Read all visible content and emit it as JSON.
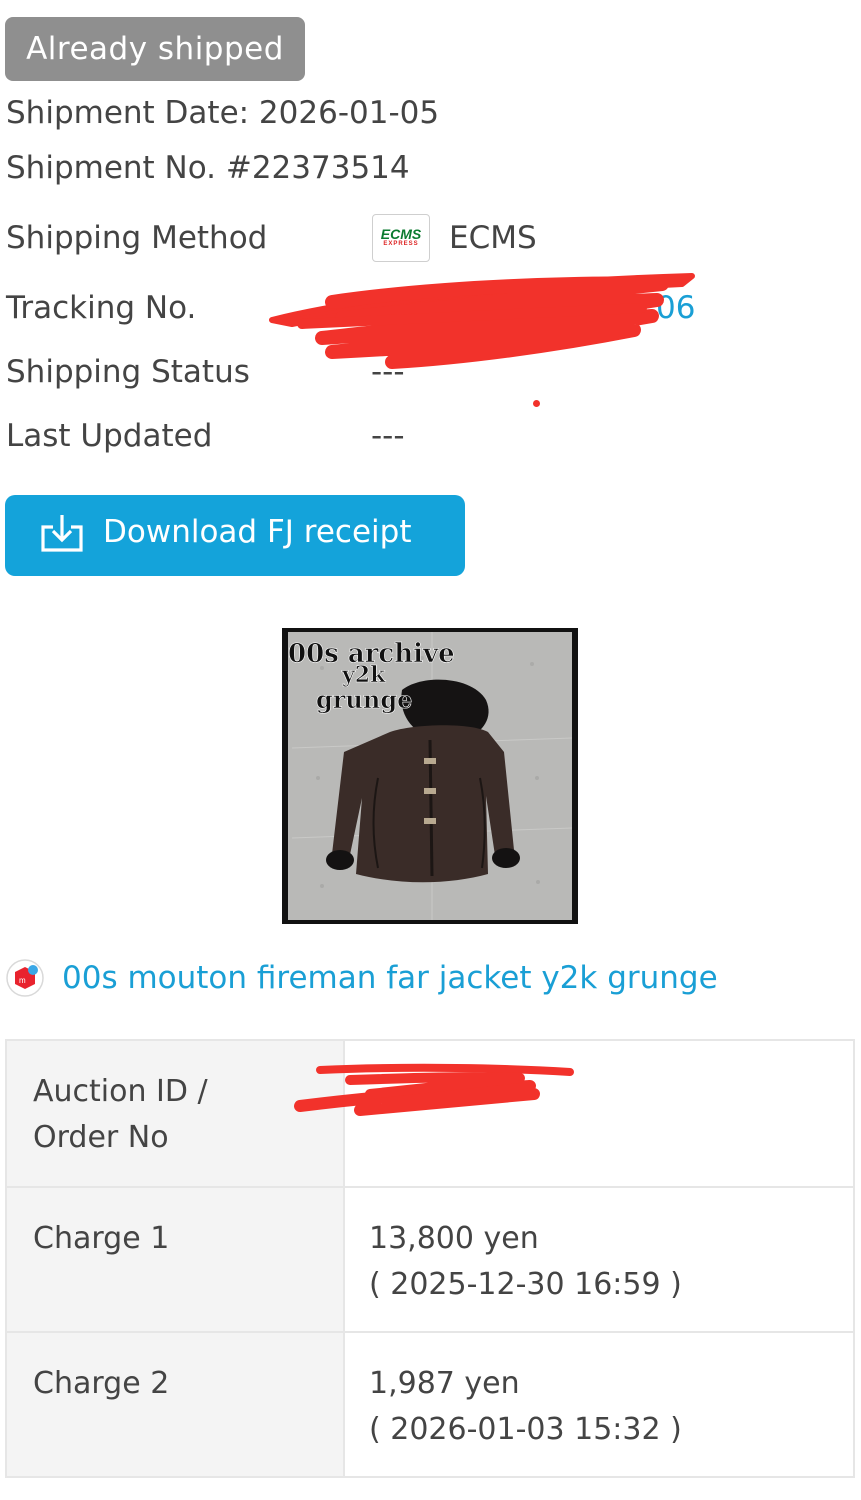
{
  "status_badge": "Already shipped",
  "shipment_date": "Shipment Date: 2026-01-05",
  "shipment_no": "Shipment No. #22373514",
  "shipping_method": {
    "label": "Shipping Method",
    "logo_text": "ECMS",
    "logo_subtext": "EXPRESS",
    "value": "ECMS"
  },
  "tracking": {
    "label": "Tracking No.",
    "value_visible_suffix": "06"
  },
  "shipping_status": {
    "label": "Shipping Status",
    "value": "---"
  },
  "last_updated": {
    "label": "Last Updated",
    "value": "---"
  },
  "download_button": {
    "label": "Download FJ receipt",
    "icon": "download-icon"
  },
  "product": {
    "thumbnail_overlay": [
      "00s archive",
      "y2k",
      "grunge"
    ],
    "shop_icon": "mercari-icon",
    "title": "00s mouton fireman far jacket y2k grunge"
  },
  "details_table": {
    "rows": [
      {
        "key_line1": "Auction ID /",
        "key_line2": "Order No",
        "value": ""
      },
      {
        "key": "Charge 1",
        "amount": "13,800 yen",
        "timestamp": "( 2025-12-30 16:59 )"
      },
      {
        "key": "Charge 2",
        "amount": "1,987 yen",
        "timestamp": "( 2026-01-03 15:32 )"
      }
    ]
  },
  "colors": {
    "accent": "#14a3da",
    "link": "#1a9fd5",
    "badge_bg": "#8f8f8f",
    "redaction": "#f2322b"
  }
}
